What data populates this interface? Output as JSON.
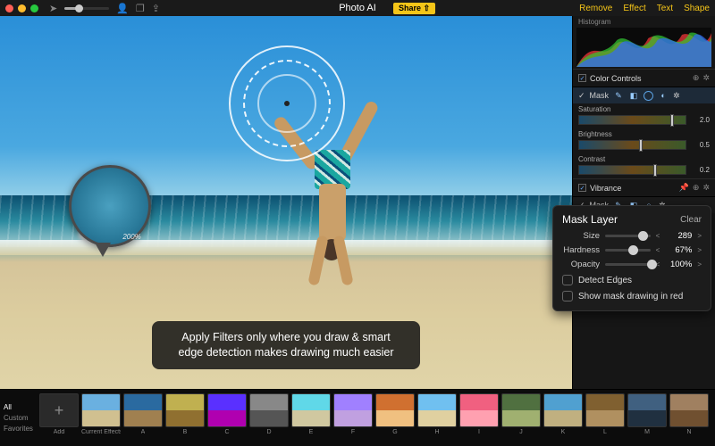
{
  "titlebar": {
    "title": "Photo AI",
    "share": "Share",
    "modes": [
      "Remove",
      "Effect",
      "Text",
      "Shape"
    ]
  },
  "canvas": {
    "loupe_zoom": "200%",
    "callout": "Apply Filters only where you draw & smart edge detection makes drawing much easier"
  },
  "panel": {
    "histogram_label": "Histogram",
    "color_controls": {
      "label": "Color Controls"
    },
    "mask1": {
      "label": "Mask"
    },
    "adjust": {
      "saturation": {
        "label": "Saturation",
        "value": "2.0",
        "pos": 86
      },
      "brightness": {
        "label": "Brightness",
        "value": "0.5",
        "pos": 56
      },
      "contrast": {
        "label": "Contrast",
        "value": "0.2",
        "pos": 70
      }
    },
    "vibrance": {
      "label": "Vibrance"
    },
    "mask2": {
      "label": "Mask"
    }
  },
  "popover": {
    "title": "Mask Layer",
    "clear": "Clear",
    "size": {
      "label": "Size",
      "value": "289",
      "unit": "",
      "pos": 74
    },
    "hardness": {
      "label": "Hardness",
      "value": "67%",
      "pos": 52
    },
    "opacity": {
      "label": "Opacity",
      "value": "100%",
      "pos": 92
    },
    "detect_edges": "Detect Edges",
    "show_red": "Show mask drawing in red"
  },
  "strip": {
    "cats": [
      "All",
      "Custom",
      "Favorites"
    ],
    "thumbs": [
      {
        "label": "Add",
        "add": true,
        "bg": ""
      },
      {
        "label": "Current Effects",
        "bg": "linear-gradient(#6ab0e0 50%,#d0c090 50%)"
      },
      {
        "label": "A",
        "bg": "linear-gradient(#2a6aa0 50%,#a08050 50%)"
      },
      {
        "label": "B",
        "bg": "linear-gradient(#c0b050 50%,#907030 50%)"
      },
      {
        "label": "C",
        "bg": "linear-gradient(#5a30ff 50%,#b000b0 50%)"
      },
      {
        "label": "D",
        "bg": "linear-gradient(#888 50%,#555 50%)"
      },
      {
        "label": "E",
        "bg": "linear-gradient(#60d8e8 50%,#d0c8a0 50%)"
      },
      {
        "label": "F",
        "bg": "linear-gradient(#a080ff 50%,#c0a0e0 50%)"
      },
      {
        "label": "G",
        "bg": "linear-gradient(#d07030 50%,#f0c080 50%)"
      },
      {
        "label": "H",
        "bg": "linear-gradient(#70c0f0 50%,#e0d0a0 50%)"
      },
      {
        "label": "I",
        "bg": "linear-gradient(#f06080 50%,#ffa0b0 50%)"
      },
      {
        "label": "J",
        "bg": "linear-gradient(#507040 50%,#a0b070 50%)"
      },
      {
        "label": "K",
        "bg": "linear-gradient(#50a0d0 50%,#c0b080 50%)"
      },
      {
        "label": "L",
        "bg": "linear-gradient(#806030 50%,#b09060 50%)"
      },
      {
        "label": "M",
        "bg": "linear-gradient(#406080 50%,#203040 50%)"
      },
      {
        "label": "N",
        "bg": "linear-gradient(#a08060 50%,#705030 50%)"
      }
    ]
  }
}
